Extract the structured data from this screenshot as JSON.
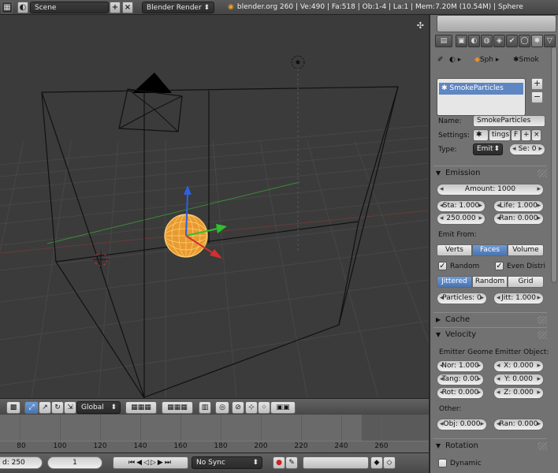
{
  "topbar": {
    "scene_name": "Scene",
    "renderer": "Blender Render",
    "stats": "blender.org 260 | Ve:490 | Fa:518 | Ob:1-4 | La:1 | Mem:7.20M (10.54M) | Sphere"
  },
  "viewport_header": {
    "orientation": "Global"
  },
  "timeline": {
    "ticks": [
      "80",
      "100",
      "120",
      "140",
      "160",
      "180",
      "200",
      "220",
      "240",
      "260"
    ],
    "end_field": "d: 250",
    "current_frame": "1",
    "sync": "No Sync"
  },
  "properties": {
    "breadcrumb_object": "Sph",
    "breadcrumb_particles": "Smok",
    "particle_system": "SmokeParticles",
    "name_label": "Name:",
    "name_value": "SmokeParticles",
    "settings_label": "Settings:",
    "settings_value": "tings",
    "settings_fake": "F",
    "type_label": "Type:",
    "type_value": "Emit",
    "seed_value": "Se: 0",
    "emission": {
      "title": "Emission",
      "amount": "Amount: 1000",
      "start": "Sta: 1.000",
      "end": "250.000",
      "life": "Life: 1.000",
      "random": "Ran: 0.000",
      "emit_from_label": "Emit From:",
      "emit_from_options": [
        "Verts",
        "Faces",
        "Volume"
      ],
      "emit_from_selected": "Faces",
      "random_check": "Random",
      "even_check": "Even Distri",
      "dist_options": [
        "Jittered",
        "Random",
        "Grid"
      ],
      "dist_selected": "Jittered",
      "particles_per_face": "Particles: 0",
      "jitter": "Jitt: 1.000"
    },
    "cache": {
      "title": "Cache"
    },
    "velocity": {
      "title": "Velocity",
      "emitter_geom_label": "Emitter Geome",
      "emitter_object_label": "Emitter Object:",
      "normal": "Nor: 1.000",
      "tangent": "Tang: 0.00",
      "rot": "Rot: 0.000",
      "x": "X: 0.000",
      "y": "Y: 0.000",
      "z": "Z: 0.000",
      "other_label": "Other:",
      "object": "Obj: 0.000",
      "random": "Ran: 0.000"
    },
    "rotation": {
      "title": "Rotation",
      "dynamic_label": "Dynamic"
    }
  },
  "colors": {
    "selection_blue": "#5f86c2",
    "sphere_orange": "#f0a030",
    "axis_red": "#d03030",
    "axis_green": "#30c030",
    "axis_blue": "#3060e0"
  }
}
